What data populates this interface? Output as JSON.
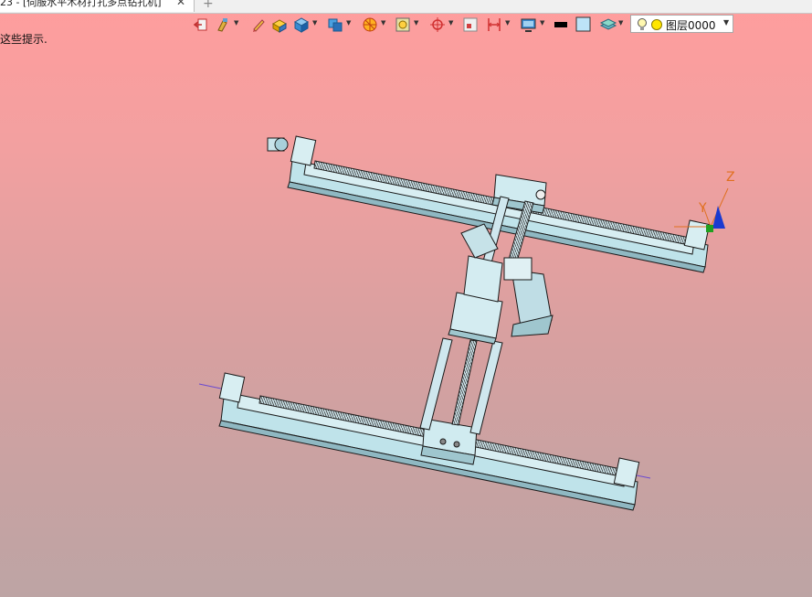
{
  "tab": {
    "title": "23 - [伺服水平木材打孔多点钻孔机]",
    "close_glyph": "✕",
    "new_tab_glyph": "+"
  },
  "hint": "这些提示.",
  "toolbar": {
    "icons": [
      "exit-icon",
      "brush-icon",
      "pencil-icon",
      "solid-icon",
      "cube-icon",
      "view-icon",
      "render-icon",
      "section-icon",
      "snap-icon",
      "select-icon",
      "dimension-icon",
      "display-icon",
      "color-black",
      "color-lightblue",
      "layer-manager-icon"
    ],
    "colors": {
      "black": "#000000",
      "light_blue": "#bde3f7",
      "accent": "#d04a20"
    }
  },
  "layer": {
    "name": "图层0000",
    "dropdown_glyph": "▼"
  },
  "axis": {
    "x": "X",
    "y": "Y",
    "z": "Z"
  }
}
